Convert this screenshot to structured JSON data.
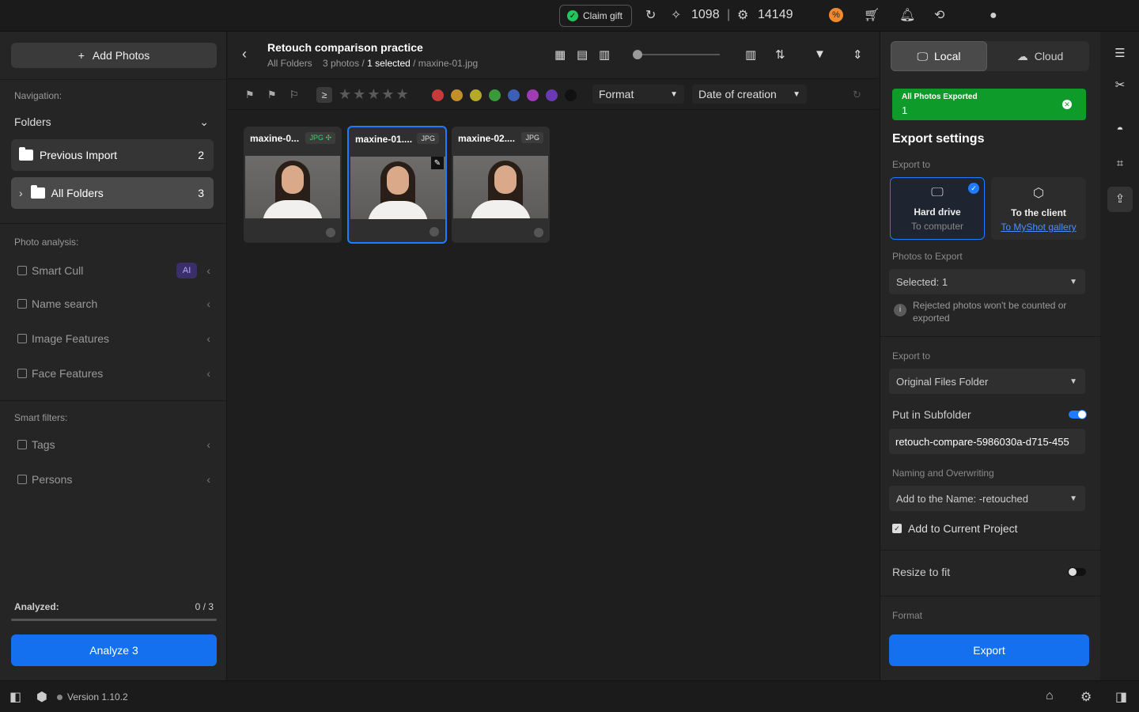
{
  "topbar": {
    "claim_label": "Claim gift",
    "credits_retouch": "1098",
    "separator": "|",
    "credits_ai": "14149"
  },
  "sidebar": {
    "add_photos_label": "Add Photos",
    "navigation_label": "Navigation:",
    "folders_label": "Folders",
    "folders": [
      {
        "label": "Previous Import",
        "count": "2"
      },
      {
        "label": "All Folders",
        "count": "3"
      }
    ],
    "photo_analysis_label": "Photo analysis:",
    "analysis_items": [
      "Smart Cull",
      "Name search",
      "Image Features",
      "Face Features"
    ],
    "ai_badge": "AI",
    "smart_filters_label": "Smart filters:",
    "filter_items": [
      "Tags",
      "Persons"
    ],
    "analyzed_label": "Analyzed:",
    "analyzed_value": "0 / 3",
    "analyzed_fraction": 0,
    "analyze_button": "Analyze 3"
  },
  "main": {
    "title": "Retouch comparison practice",
    "path_folder": "All Folders",
    "path_count": "3 photos /",
    "path_selected": "1 selected",
    "path_file": "/ maxine-01.jpg",
    "rating_operator": "≥",
    "format_dropdown": "Format",
    "date_dropdown": "Date of creation",
    "color_labels": [
      "#c73a3a",
      "#c2902a",
      "#b5a82a",
      "#3a9a3a",
      "#3a5fb5",
      "#a03ab5",
      "#6a3ab5",
      "#111111"
    ],
    "photos": [
      {
        "name": "maxine-0...",
        "format": "JPG",
        "selected": false
      },
      {
        "name": "maxine-01....",
        "format": "JPG",
        "selected": true
      },
      {
        "name": "maxine-02....",
        "format": "JPG",
        "selected": false
      }
    ]
  },
  "export": {
    "tab_local": "Local",
    "tab_cloud": "Cloud",
    "toast_title": "All Photos Exported",
    "toast_count": "1",
    "title": "Export settings",
    "export_to_label": "Export to",
    "target_hd_title": "Hard drive",
    "target_hd_sub": "To computer",
    "target_client_title": "To the client",
    "target_client_sub": "To MyShot gallery",
    "photos_to_export_label": "Photos to Export",
    "photos_to_export_value": "Selected: 1",
    "info_text": "Rejected photos won't be counted or exported",
    "export_to2_label": "Export to",
    "export_to2_value": "Original Files Folder",
    "subfolder_label": "Put in Subfolder",
    "subfolder_value": "retouch-compare-5986030a-d715-455",
    "naming_label": "Naming and Overwriting",
    "naming_value": "Add to the Name: -retouched",
    "add_project_label": "Add to Current Project",
    "resize_label": "Resize to fit",
    "format_label": "Format",
    "export_button": "Export"
  },
  "footer": {
    "version": "Version 1.10.2"
  }
}
